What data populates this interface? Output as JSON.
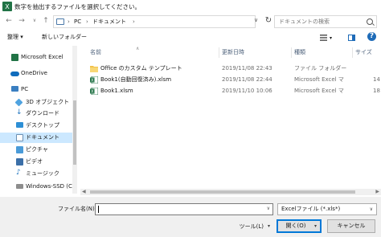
{
  "window": {
    "title": "数字を抽出するファイルを選択してください。",
    "accent_color": "#217346"
  },
  "address": {
    "crumbs": [
      "PC",
      "ドキュメント"
    ],
    "search_placeholder": "ドキュメントの検索"
  },
  "toolbar": {
    "organize_label": "整理 ▾",
    "new_folder_label": "新しいフォルダー"
  },
  "nav": {
    "items": [
      {
        "label": "Microsoft Excel",
        "icon": "excel-icon",
        "selected": false
      },
      {
        "label": "OneDrive",
        "icon": "cloud-icon",
        "selected": false
      },
      {
        "label": "PC",
        "icon": "pc-icon",
        "selected": false
      },
      {
        "label": "3D オブジェクト",
        "icon": "cube-icon",
        "selected": false
      },
      {
        "label": "ダウンロード",
        "icon": "download-icon",
        "selected": false
      },
      {
        "label": "デスクトップ",
        "icon": "desktop-icon",
        "selected": false
      },
      {
        "label": "ドキュメント",
        "icon": "document-icon",
        "selected": true
      },
      {
        "label": "ピクチャ",
        "icon": "picture-icon",
        "selected": false
      },
      {
        "label": "ビデオ",
        "icon": "video-icon",
        "selected": false
      },
      {
        "label": "ミュージック",
        "icon": "music-icon",
        "selected": false
      },
      {
        "label": "Windows-SSD (C",
        "icon": "drive-icon",
        "selected": false
      }
    ]
  },
  "columns": {
    "name": "名前",
    "modified": "更新日時",
    "type": "種類",
    "size": "サイズ"
  },
  "files": [
    {
      "name": "Office のカスタム テンプレート",
      "modified": "2019/11/08 22:43",
      "type": "ファイル フォルダー",
      "size": "",
      "icon": "folder-icon"
    },
    {
      "name": "Book1(自動回復済み).xlsm",
      "modified": "2019/11/08 22:44",
      "type": "Microsoft Excel マ",
      "size": "14",
      "icon": "excel-file-icon"
    },
    {
      "name": "Book1.xlsm",
      "modified": "2019/11/10 10:06",
      "type": "Microsoft Excel マ",
      "size": "18",
      "icon": "excel-file-icon"
    }
  ],
  "footer": {
    "filename_label": "ファイル名(N):",
    "filename_value": "",
    "filetype_value": "Excelファイル (*.xls*)",
    "tools_label": "ツール(L)",
    "open_label": "開く(O)",
    "cancel_label": "キャンセル"
  }
}
